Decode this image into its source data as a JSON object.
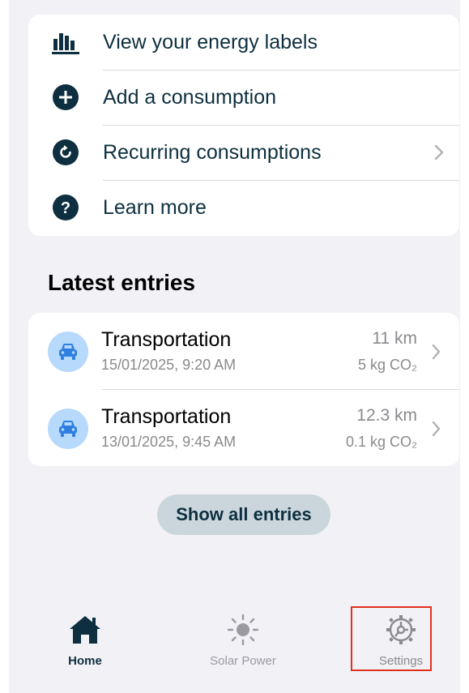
{
  "actions": [
    {
      "label": "View your energy labels",
      "icon": "bar-chart-icon",
      "has_chevron": false
    },
    {
      "label": "Add a consumption",
      "icon": "plus-circle-icon",
      "has_chevron": false
    },
    {
      "label": "Recurring consumptions",
      "icon": "refresh-circle-icon",
      "has_chevron": true
    },
    {
      "label": "Learn more",
      "icon": "question-circle-icon",
      "has_chevron": false
    }
  ],
  "latest": {
    "title": "Latest entries",
    "entries": [
      {
        "title": "Transportation",
        "date": "15/01/2025, 9:20 AM",
        "amount": "11 km",
        "co2": "5 kg CO₂",
        "icon": "car-icon"
      },
      {
        "title": "Transportation",
        "date": "13/01/2025, 9:45 AM",
        "amount": "12.3 km",
        "co2": "0.1 kg CO₂",
        "icon": "car-icon"
      }
    ],
    "show_all_label": "Show all entries"
  },
  "tabbar": {
    "tabs": [
      {
        "label": "Home",
        "icon": "home-icon",
        "active": true
      },
      {
        "label": "Solar Power",
        "icon": "sun-icon",
        "active": false
      },
      {
        "label": "Settings",
        "icon": "gear-icon",
        "active": false,
        "highlighted": true
      }
    ]
  },
  "colors": {
    "primary": "#0d2f3f",
    "background": "#f2f1f6",
    "card": "#ffffff",
    "avatar": "#b7d9fb",
    "car_icon": "#2f7fe0",
    "button": "#cbd6dc",
    "highlight": "#e0311e"
  }
}
